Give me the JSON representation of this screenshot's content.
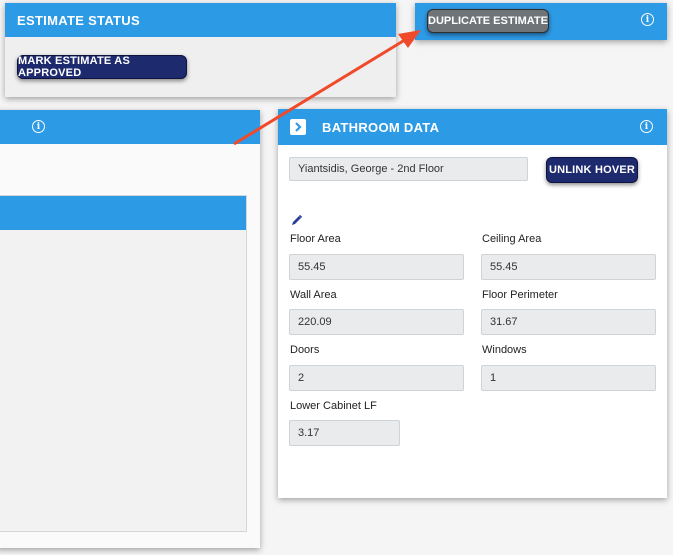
{
  "estimate_status": {
    "title": "ESTIMATE STATUS",
    "approve_button": "MARK ESTIMATE AS APPROVED"
  },
  "duplicate_panel": {
    "duplicate_button": "DUPLICATE ESTIMATE"
  },
  "bathroom": {
    "title": "BATHROOM DATA",
    "selection": "Yiantsidis, George - 2nd Floor",
    "unlink_button": "UNLINK HOVER",
    "fields": {
      "floor_area": {
        "label": "Floor Area",
        "value": "55.45"
      },
      "ceiling_area": {
        "label": "Ceiling Area",
        "value": "55.45"
      },
      "wall_area": {
        "label": "Wall Area",
        "value": "220.09"
      },
      "floor_perimeter": {
        "label": "Floor Perimeter",
        "value": "31.67"
      },
      "doors": {
        "label": "Doors",
        "value": "2"
      },
      "windows": {
        "label": "Windows",
        "value": "1"
      },
      "lower_cabinet_lf": {
        "label": "Lower Cabinet LF",
        "value": "3.17"
      }
    }
  },
  "colors": {
    "header_blue": "#2d9ae6",
    "dark_button": "#1e2a6e",
    "gray_button": "#6f7478",
    "arrow": "#f04a2a"
  }
}
